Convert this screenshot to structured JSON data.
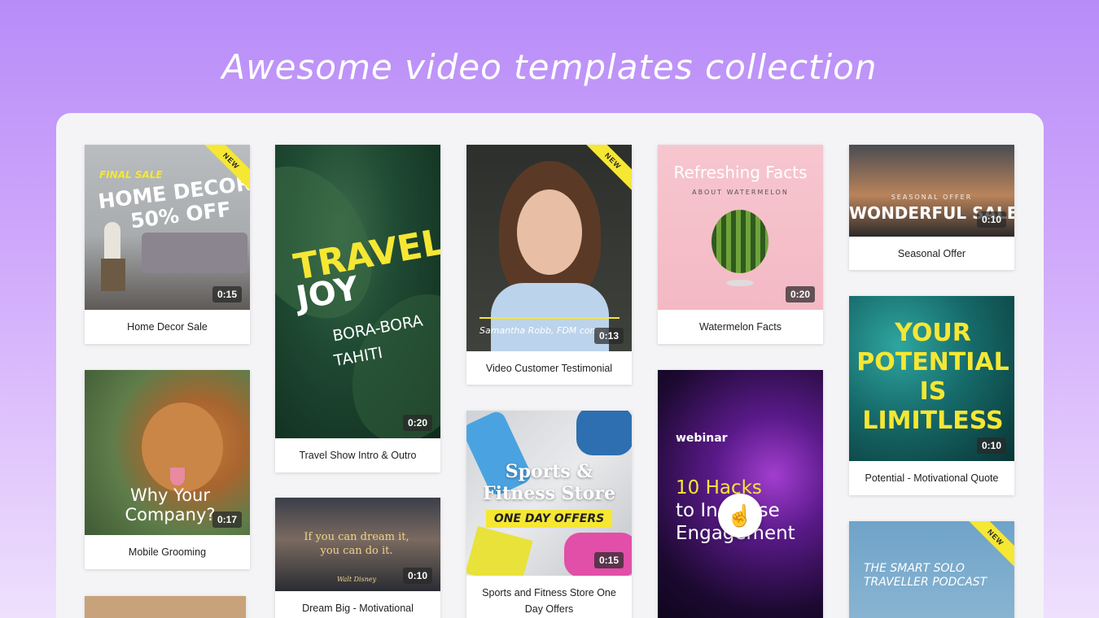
{
  "heading": "Awesome video templates collection",
  "new_badge": "NEW",
  "cards": {
    "home_decor": {
      "caption": "Home Decor Sale",
      "duration": "0:15",
      "line1": "FINAL SALE",
      "line2": "HOME DECOR",
      "line3": "50% OFF"
    },
    "travel": {
      "caption": "Travel Show Intro & Outro",
      "duration": "0:20",
      "line1": "TRAVEL",
      "line2": "JOY",
      "line3": "BORA-BORA",
      "line4": "TAHITI"
    },
    "testimonial": {
      "caption": "Video Customer Testimonial",
      "duration": "0:13",
      "overlay": "Samantha Robb, FDM consu"
    },
    "watermelon": {
      "caption": "Watermelon Facts",
      "duration": "0:20",
      "title": "Refreshing Facts",
      "subtitle": "ABOUT WATERMELON"
    },
    "seasonal": {
      "caption": "Seasonal Offer",
      "duration": "0:10",
      "small": "SEASONAL OFFER",
      "big": "WONDERFUL SALE"
    },
    "grooming": {
      "caption": "Mobile Grooming",
      "duration": "0:17",
      "text": "Why Your Company?"
    },
    "dream": {
      "caption": "Dream Big - Motivational",
      "duration": "0:10",
      "quote": "If you can dream it, you can do it.",
      "author": "Walt Disney"
    },
    "sports": {
      "caption": "Sports and Fitness Store One Day Offers",
      "duration": "0:15",
      "line1": "Sports &",
      "line2": "Fitness Store",
      "line3": "ONE DAY OFFERS"
    },
    "webinar": {
      "label": "webinar",
      "line1": "10 Hacks",
      "line2": "to Increase",
      "line3": "Engagement"
    },
    "potential": {
      "caption": "Potential - Motivational Quote",
      "duration": "0:10",
      "text": "YOUR POTENTIAL IS LIMITLESS"
    },
    "podcast": {
      "text": "THE SMART SOLO TRAVELLER PODCAST"
    }
  },
  "colors": {
    "accent_yellow": "#f6e733",
    "bg_top": "#b88cf8",
    "panel": "#f4f4f6"
  }
}
